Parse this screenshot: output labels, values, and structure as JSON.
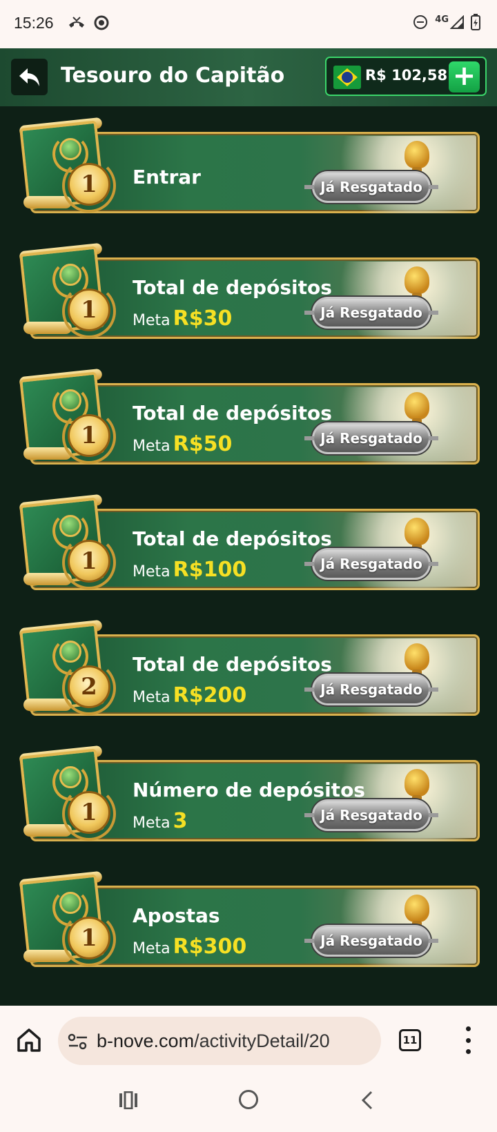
{
  "status_bar": {
    "time": "15:26",
    "network": "4G",
    "icons": [
      "missed-call-icon",
      "chrome-icon",
      "dnd-icon",
      "signal-icon",
      "battery-charging-icon"
    ]
  },
  "header": {
    "back_icon": "back-arrow-icon",
    "title": "Tesouro do Capitão",
    "balance": "R$ 102,58",
    "flag": "brazil-flag-icon",
    "add_icon": "plus-icon",
    "colors": {
      "header_bg": "#2d6443",
      "accent": "#3bd66a",
      "page_bg": "#0e2016"
    }
  },
  "tasks": [
    {
      "title": "Entrar",
      "meta_label": "",
      "meta_value": "",
      "badge": "1",
      "button": "Já Resgatado"
    },
    {
      "title": "Total de depósitos",
      "meta_label": "Meta",
      "meta_value": "R$30",
      "badge": "1",
      "button": "Já Resgatado"
    },
    {
      "title": "Total de depósitos",
      "meta_label": "Meta",
      "meta_value": "R$50",
      "badge": "1",
      "button": "Já Resgatado"
    },
    {
      "title": "Total de depósitos",
      "meta_label": "Meta",
      "meta_value": "R$100",
      "badge": "1",
      "button": "Já Resgatado"
    },
    {
      "title": "Total de depósitos",
      "meta_label": "Meta",
      "meta_value": "R$200",
      "badge": "2",
      "button": "Já Resgatado"
    },
    {
      "title": "Número de depósitos",
      "meta_label": "Meta",
      "meta_value": "3",
      "badge": "1",
      "button": "Já Resgatado"
    },
    {
      "title": "Apostas",
      "meta_label": "Meta",
      "meta_value": "R$300",
      "badge": "1",
      "button": "Já Resgatado"
    }
  ],
  "browser": {
    "url_domain": "b-nove.com",
    "url_path": "/activityDetail/20",
    "tab_count": "11"
  }
}
